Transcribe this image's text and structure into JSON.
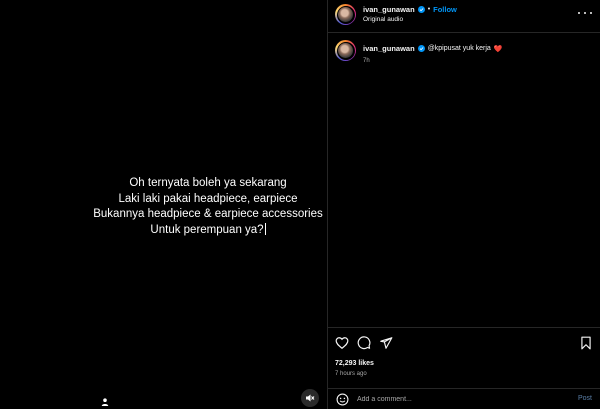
{
  "media": {
    "caption_lines": [
      "Oh ternyata boleh ya sekarang",
      "Laki laki pakai headpiece, earpiece",
      "Bukannya headpiece & earpiece accessories",
      "Untuk perempuan ya?"
    ],
    "tag_icon": "user-icon",
    "mute_icon": "muted-speaker-icon"
  },
  "header": {
    "username": "ivan_gunawan",
    "verified_icon": "verified-badge-icon",
    "separator": "•",
    "follow_label": "Follow",
    "subline": "Original audio",
    "more_icon": "more-options-icon"
  },
  "caption_comment": {
    "username": "ivan_gunawan",
    "text": "@kpipusat yuk kerja",
    "emoji": "❤️",
    "time": "7h"
  },
  "actions": {
    "like_icon": "heart-icon",
    "comment_icon": "comment-icon",
    "share_icon": "share-icon",
    "save_icon": "bookmark-icon"
  },
  "stats": {
    "likes": "72,293 likes",
    "ago": "7 hours ago"
  },
  "add_comment": {
    "placeholder": "Add a comment...",
    "post_label": "Post",
    "emoji_icon": "emoji-icon"
  },
  "colors": {
    "accent": "#0095f6",
    "background": "#000000",
    "text": "#f5f5f5",
    "muted": "#a8a8a8",
    "heart": "#ed4956"
  }
}
